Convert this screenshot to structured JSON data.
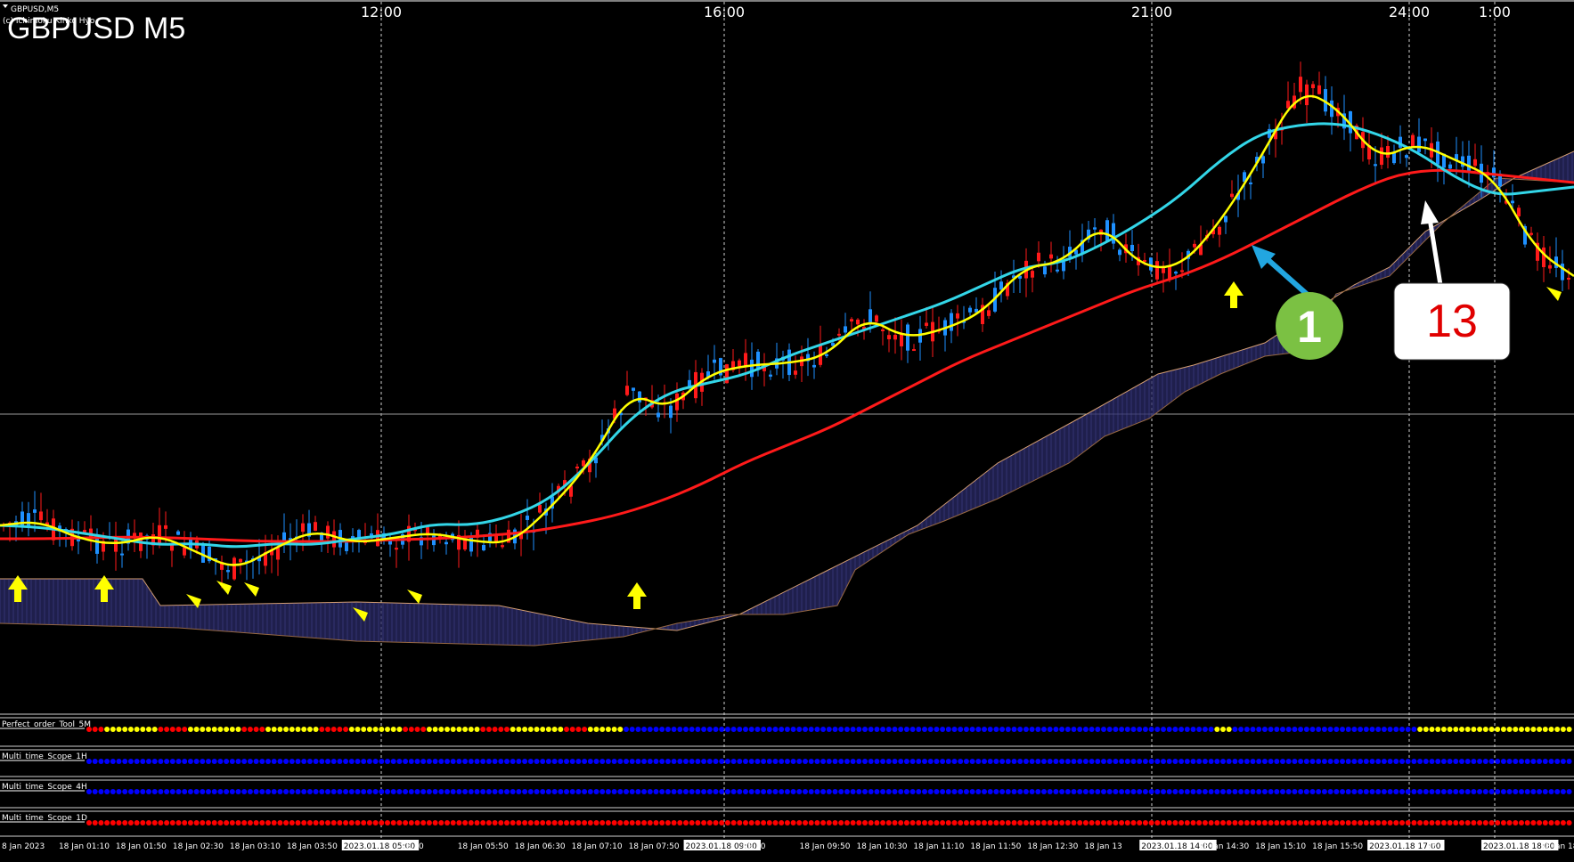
{
  "window": {
    "symbol_small": "GBPUSD,M5",
    "copyright_small": "(c) Ichimoku Kinko Hyo",
    "title": "GBPUSD M5"
  },
  "hour_labels": [
    "12:00",
    "16:00",
    "21:00",
    "24:00",
    "1:00"
  ],
  "panels": [
    {
      "name": "Perfect_order_Tool_5M"
    },
    {
      "name": "Multi_time_Scope_1H"
    },
    {
      "name": "Multi_time_Scope_4H"
    },
    {
      "name": "Multi_time_Scope_1D"
    }
  ],
  "time_axis": [
    "8 Jan 2023",
    "18 Jan 01:10",
    "18 Jan 01:50",
    "18 Jan 02:30",
    "18 Jan 03:10",
    "18 Jan 03:50",
    "2023.01.18 05:00",
    "05:10",
    "18 Jan 05:50",
    "18 Jan 06:30",
    "18 Jan 07:10",
    "18 Jan 07:50",
    "2023.01.18 09:00",
    "09:10",
    "18 Jan 09:50",
    "18 Jan 10:30",
    "18 Jan 11:10",
    "18 Jan 11:50",
    "18 Jan 12:30",
    "18 Jan 13",
    "2023.01.18 14:00",
    "18 Jan 14:30",
    "18 Jan 15:10",
    "18 Jan 15:50",
    "2023.01.18 17:00",
    "17",
    "2023.01.18 18:00",
    "18 Jan 18:"
  ],
  "annotations": {
    "green_badge": "1",
    "white_box": "13"
  },
  "colors": {
    "bull": "#1e90ff",
    "bear": "#ff1a1a",
    "fast_ma": "#ffff00",
    "mid_ma": "#33d6e8",
    "slow_ma": "#ff1a1a",
    "cloud": "#5a5aa0",
    "span": "#d8a070",
    "dot_blue": "#0000ff",
    "dot_red": "#ff0000",
    "dot_yellow": "#ffff00",
    "arrow_buy": "#ffff00",
    "arrow_blue": "#22a6e0",
    "badge": "#7bc143"
  },
  "chart_data": {
    "type": "line",
    "title": "GBPUSD M5",
    "x_labels": [
      "12:00",
      "16:00",
      "21:00",
      "24:00",
      "1:00"
    ],
    "series": [
      {
        "values": [
          590,
          585,
          605,
          612,
          600,
          620,
          640,
          615,
          595,
          610,
          604,
          598,
          608,
          610,
          570,
          520,
          440,
          460,
          420,
          410,
          408,
          400,
          355,
          380,
          370,
          350,
          300,
          295,
          250,
          300,
          300,
          250,
          180,
          100,
          120,
          180,
          160,
          180,
          200,
          280,
          310
        ]
      },
      {
        "values": [
          590,
          592,
          598,
          605,
          612,
          610,
          615,
          610,
          612,
          605,
          600,
          588,
          590,
          580,
          560,
          520,
          470,
          440,
          430,
          420,
          400,
          385,
          370,
          355,
          340,
          320,
          300,
          295,
          275,
          250,
          220,
          180,
          150,
          140,
          138,
          150,
          170,
          200,
          220,
          215,
          210
        ]
      },
      {
        "values": [
          605,
          605,
          604,
          603,
          604,
          606,
          608,
          608,
          608,
          606,
          605,
          602,
          598,
          590,
          580,
          565,
          545,
          520,
          500,
          480,
          455,
          430,
          405,
          385,
          365,
          345,
          325,
          310,
          290,
          265,
          240,
          215,
          195,
          190,
          195,
          200,
          205
        ]
      }
    ]
  }
}
